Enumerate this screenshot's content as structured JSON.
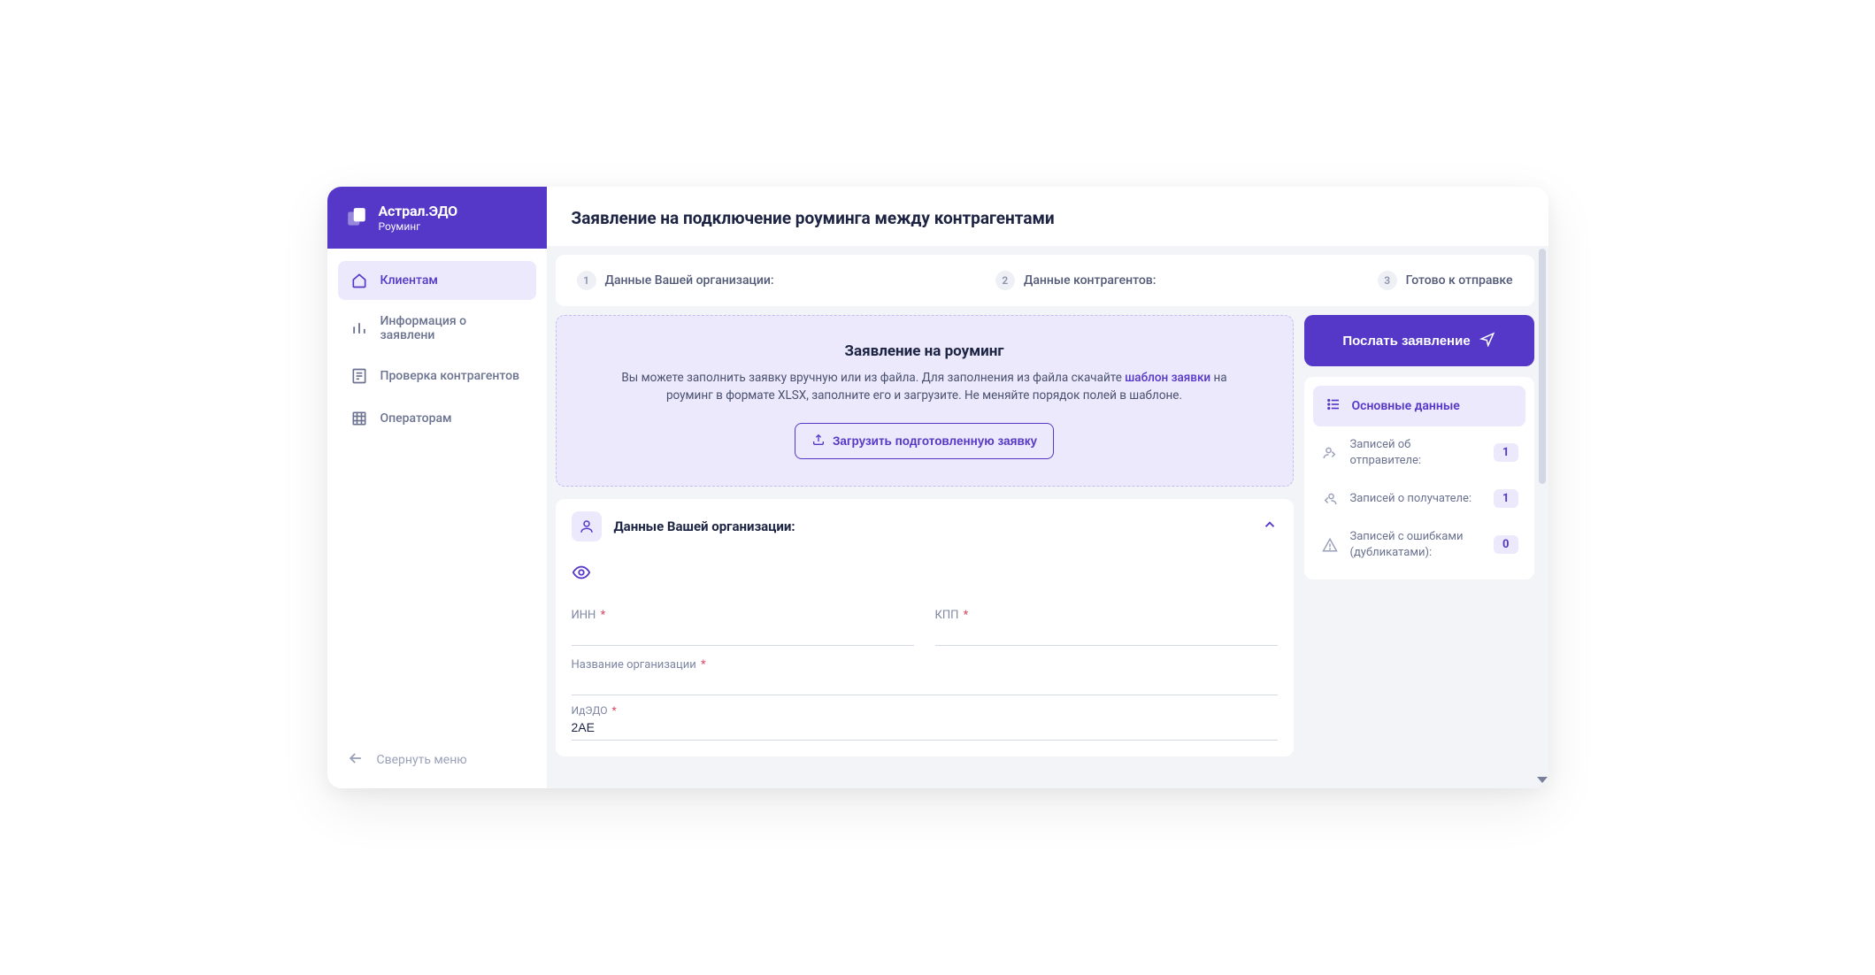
{
  "brand": {
    "title": "Астрал.ЭДО",
    "subtitle": "Роуминг"
  },
  "nav": {
    "items": [
      {
        "label": "Клиентам"
      },
      {
        "label": "Информация о заявлени"
      },
      {
        "label": "Проверка контрагентов"
      },
      {
        "label": "Операторам"
      }
    ],
    "collapse_label": "Свернуть меню"
  },
  "page_title": "Заявление на подключение роуминга между контрагентами",
  "steps": [
    {
      "num": "1",
      "label": "Данные Вашей организации:"
    },
    {
      "num": "2",
      "label": "Данные контрагентов:"
    },
    {
      "num": "3",
      "label": "Готово к отправке"
    }
  ],
  "callout": {
    "title": "Заявление на роуминг",
    "desc_before": "Вы можете заполнить заявку вручную или из файла. Для заполнения из файла скачайте ",
    "link_label": "шаблон заявки",
    "desc_after": " на роуминг в формате XLSX, заполните его и загрузите. Не меняйте порядок полей в шаблоне.",
    "upload_label": "Загрузить подготовленную заявку"
  },
  "org_panel": {
    "title": "Данные Вашей организации:",
    "fields": {
      "inn_label": "ИНН",
      "kpp_label": "КПП",
      "org_name_label": "Название организации",
      "idedo_label": "ИдЭДО",
      "idedo_value": "2AE"
    }
  },
  "submit_label": "Послать заявление",
  "stats": {
    "header": "Основные данные",
    "rows": [
      {
        "label": "Записей об отправителе:",
        "value": "1"
      },
      {
        "label": "Записей о получателе:",
        "value": "1"
      },
      {
        "label": "Записей с ошибками (дубликатами):",
        "value": "0"
      }
    ]
  }
}
